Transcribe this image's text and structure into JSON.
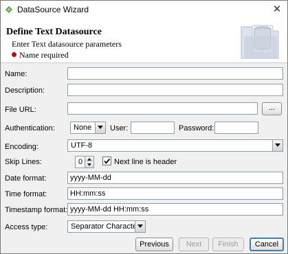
{
  "window": {
    "title": "DataSource Wizard",
    "close_label": "✕"
  },
  "header": {
    "title": "Define Text Datasource",
    "subtitle": "Enter Text datasource parameters",
    "required_note": "Name required"
  },
  "form": {
    "name": {
      "label": "Name:",
      "value": ""
    },
    "description": {
      "label": "Description:",
      "value": ""
    },
    "file_url": {
      "label": "File URL:",
      "value": "",
      "browse_label": "..."
    },
    "authentication": {
      "label": "Authentication:",
      "selected": "None"
    },
    "user": {
      "label": "User:",
      "value": ""
    },
    "password": {
      "label": "Password:",
      "value": ""
    },
    "encoding": {
      "label": "Encoding:",
      "selected": "UTF-8"
    },
    "skip_lines": {
      "label": "Skip Lines:",
      "value": "0"
    },
    "next_line_header": {
      "label": "Next line is header",
      "checked": true
    },
    "date_format": {
      "label": "Date format:",
      "value": "yyyy-MM-dd"
    },
    "time_format": {
      "label": "Time format:",
      "value": "HH:mm:ss"
    },
    "timestamp_format": {
      "label": "Timestamp format:",
      "value": "yyyy-MM-dd HH:mm:ss"
    },
    "access_type": {
      "label": "Access type:",
      "selected": "Separator Character"
    }
  },
  "buttons": {
    "previous": "Previous",
    "next": "Next",
    "finish": "Finish",
    "cancel": "Cancel"
  },
  "colors": {
    "required_dot": "#cc0000",
    "focus_border": "#3c7fb1"
  }
}
